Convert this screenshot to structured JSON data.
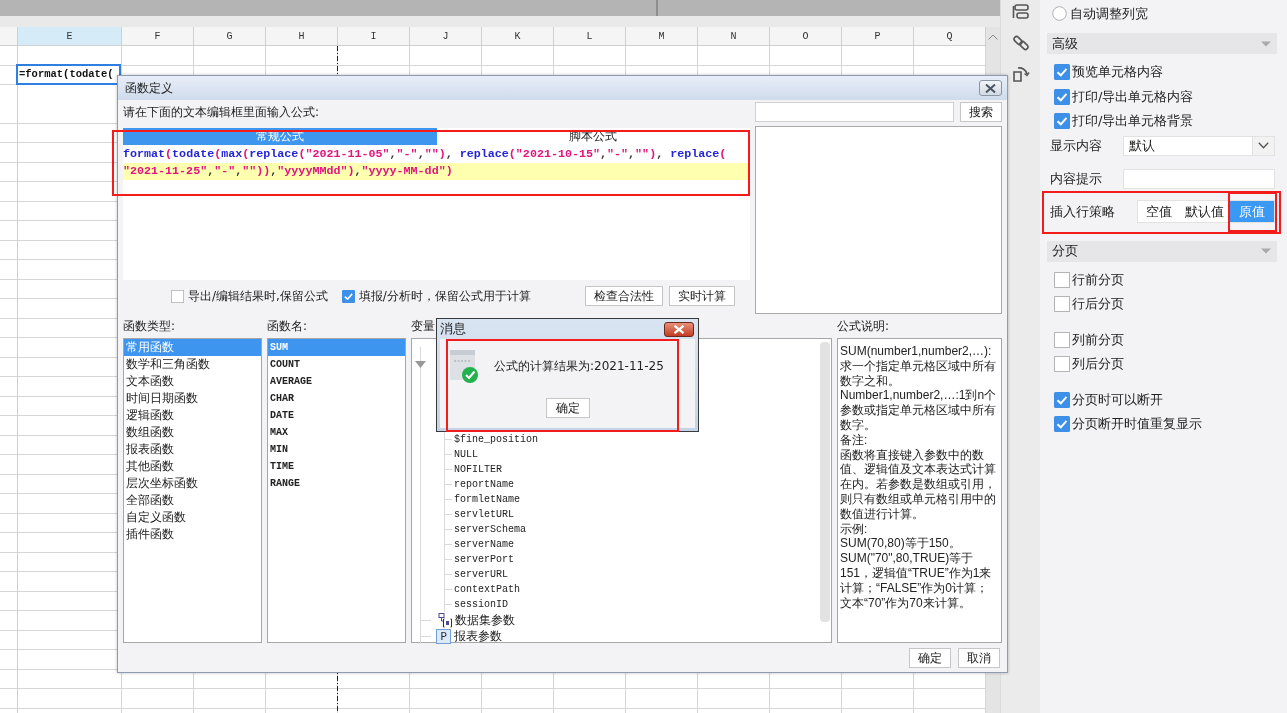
{
  "sheet": {
    "columns": [
      {
        "label": "E",
        "selected": true,
        "page_break": false
      },
      {
        "label": "F",
        "selected": false,
        "page_break": false
      },
      {
        "label": "G",
        "selected": false,
        "page_break": false
      },
      {
        "label": "H",
        "selected": false,
        "page_break": true
      },
      {
        "label": "I",
        "selected": false,
        "page_break": false
      },
      {
        "label": "J",
        "selected": false,
        "page_break": false
      },
      {
        "label": "K",
        "selected": false,
        "page_break": false
      },
      {
        "label": "L",
        "selected": false,
        "page_break": false
      },
      {
        "label": "M",
        "selected": false,
        "page_break": false
      },
      {
        "label": "N",
        "selected": false,
        "page_break": false
      },
      {
        "label": "O",
        "selected": false,
        "page_break": false
      },
      {
        "label": "P",
        "selected": false,
        "page_break": false
      },
      {
        "label": "Q",
        "selected": false,
        "page_break": false
      }
    ],
    "active_cell": {
      "text": "=format(todate("
    }
  },
  "formula_dialog": {
    "title": "函数定义",
    "prompt": "请在下面的文本编辑框里面输入公式:",
    "editor": {
      "highlighted": true,
      "tabs": [
        {
          "label": "常规公式",
          "selected": true
        },
        {
          "label": "脚本公式",
          "selected": false
        }
      ],
      "lines": [
        {
          "current": false,
          "tokens": [
            {
              "kind": "function",
              "text": "format"
            },
            {
              "kind": "literal",
              "text": "("
            },
            {
              "kind": "function",
              "text": "todate"
            },
            {
              "kind": "literal",
              "text": "("
            },
            {
              "kind": "function",
              "text": "max"
            },
            {
              "kind": "literal",
              "text": "("
            },
            {
              "kind": "function",
              "text": "replace"
            },
            {
              "kind": "literal",
              "text": "(\"2021-11-05\""
            },
            {
              "kind": "separator",
              "text": ","
            },
            {
              "kind": "literal",
              "text": "\"-\""
            },
            {
              "kind": "separator",
              "text": ","
            },
            {
              "kind": "literal",
              "text": "\"\")"
            },
            {
              "kind": "separator",
              "text": ", "
            },
            {
              "kind": "function",
              "text": "replace"
            },
            {
              "kind": "literal",
              "text": "(\"2021-10-15\""
            },
            {
              "kind": "separator",
              "text": ","
            },
            {
              "kind": "literal",
              "text": "\"-\""
            },
            {
              "kind": "separator",
              "text": ","
            },
            {
              "kind": "literal",
              "text": "\"\")"
            },
            {
              "kind": "separator",
              "text": ", "
            },
            {
              "kind": "function",
              "text": "replace"
            },
            {
              "kind": "literal",
              "text": "("
            }
          ]
        },
        {
          "current": true,
          "tokens": [
            {
              "kind": "literal",
              "text": "\"2021-11-25\""
            },
            {
              "kind": "separator",
              "text": ","
            },
            {
              "kind": "literal",
              "text": "\"-\""
            },
            {
              "kind": "separator",
              "text": ","
            },
            {
              "kind": "literal",
              "text": "\"\"))"
            },
            {
              "kind": "separator",
              "text": ","
            },
            {
              "kind": "literal",
              "text": "\"yyyyMMdd\")"
            },
            {
              "kind": "separator",
              "text": ","
            },
            {
              "kind": "literal",
              "text": "\"yyyy-MM-dd\")"
            }
          ]
        }
      ]
    },
    "search": {
      "button": "搜索"
    },
    "options": [
      {
        "label": "导出/编辑结果时,保留公式",
        "checked": false
      },
      {
        "label": "填报/分析时，保留公式用于计算",
        "checked": true
      }
    ],
    "actions": [
      "检查合法性",
      "实时计算"
    ],
    "function_types": {
      "label": "函数类型:",
      "items": [
        {
          "label": "常用函数",
          "selected": true
        },
        {
          "label": "数学和三角函数",
          "selected": false
        },
        {
          "label": "文本函数",
          "selected": false
        },
        {
          "label": "时间日期函数",
          "selected": false
        },
        {
          "label": "逻辑函数",
          "selected": false
        },
        {
          "label": "数组函数",
          "selected": false
        },
        {
          "label": "报表函数",
          "selected": false
        },
        {
          "label": "其他函数",
          "selected": false
        },
        {
          "label": "层次坐标函数",
          "selected": false
        },
        {
          "label": "全部函数",
          "selected": false
        },
        {
          "label": "自定义函数",
          "selected": false
        },
        {
          "label": "插件函数",
          "selected": false
        }
      ]
    },
    "function_names": {
      "label": "函数名:",
      "items": [
        {
          "label": "SUM",
          "selected": true
        },
        {
          "label": "COUNT",
          "selected": false
        },
        {
          "label": "AVERAGE",
          "selected": false
        },
        {
          "label": "CHAR",
          "selected": false
        },
        {
          "label": "DATE",
          "selected": false
        },
        {
          "label": "MAX",
          "selected": false
        },
        {
          "label": "MIN",
          "selected": false
        },
        {
          "label": "TIME",
          "selected": false
        },
        {
          "label": "RANGE",
          "selected": false
        }
      ]
    },
    "variables": {
      "label": "变量",
      "nodes": [
        {
          "kind": "group",
          "expanded": true,
          "children": [
            {
              "label": "$fine_position"
            },
            {
              "label": "NULL"
            },
            {
              "label": "NOFILTER"
            },
            {
              "label": "reportName"
            },
            {
              "label": "formletName"
            },
            {
              "label": "servletURL"
            },
            {
              "label": "serverSchema"
            },
            {
              "label": "serverName"
            },
            {
              "label": "serverPort"
            },
            {
              "label": "serverURL"
            },
            {
              "label": "contextPath"
            },
            {
              "label": "sessionID"
            }
          ]
        },
        {
          "kind": "dataset",
          "label": "数据集参数"
        },
        {
          "kind": "param",
          "label": "报表参数",
          "badge": "P"
        }
      ]
    },
    "description": {
      "label": "公式说明:",
      "paragraphs": [
        "SUM(number1,number2,…):求一个指定单元格区域中所有数字之和。",
        "Number1,number2,…:1到n个参数或指定单元格区域中所有数字。",
        "备注:",
        "函数将直接键入参数中的数值、逻辑值及文本表达式计算在内。若参数是数组或引用，则只有数组或单元格引用中的数值进行计算。",
        "示例:",
        "SUM(70,80)等于150。",
        "SUM(\"70\",80,TRUE)等于151，逻辑值“TRUE”作为1来计算；“FALSE”作为0计算；文本“70”作为70来计算。"
      ]
    },
    "buttons": [
      "确定",
      "取消"
    ]
  },
  "message_dialog": {
    "title": "消息",
    "text": "公式的计算结果为:2021-11-25",
    "button": "确定",
    "highlighted": true
  },
  "properties_panel": {
    "auto_width": {
      "label": "自动调整列宽",
      "checked": false
    },
    "sections": [
      {
        "title": "高级",
        "expanded": true,
        "groups": [
          {
            "items": [
              {
                "kind": "checkbox",
                "label": "预览单元格内容",
                "checked": true
              },
              {
                "kind": "checkbox",
                "label": "打印/导出单元格内容",
                "checked": true
              },
              {
                "kind": "checkbox",
                "label": "打印/导出单元格背景",
                "checked": true
              },
              {
                "kind": "select",
                "label": "显示内容",
                "value": "默认"
              },
              {
                "kind": "input",
                "label": "内容提示"
              },
              {
                "kind": "segmented",
                "label": "插入行策略",
                "highlighted": true,
                "options": [
                  {
                    "label": "空值",
                    "selected": false,
                    "highlighted": false
                  },
                  {
                    "label": "默认值",
                    "selected": false,
                    "highlighted": false
                  },
                  {
                    "label": "原值",
                    "selected": true,
                    "highlighted": true
                  }
                ]
              }
            ]
          }
        ]
      },
      {
        "title": "分页",
        "expanded": true,
        "groups": [
          {
            "items": [
              {
                "kind": "checkbox",
                "label": "行前分页",
                "checked": false
              },
              {
                "kind": "checkbox",
                "label": "行后分页",
                "checked": false
              }
            ]
          },
          {
            "items": [
              {
                "kind": "checkbox",
                "label": "列前分页",
                "checked": false
              },
              {
                "kind": "checkbox",
                "label": "列后分页",
                "checked": false
              }
            ]
          },
          {
            "items": [
              {
                "kind": "checkbox",
                "label": "分页时可以断开",
                "checked": true
              },
              {
                "kind": "checkbox",
                "label": "分页断开时值重复显示",
                "checked": true
              }
            ]
          }
        ]
      }
    ]
  }
}
